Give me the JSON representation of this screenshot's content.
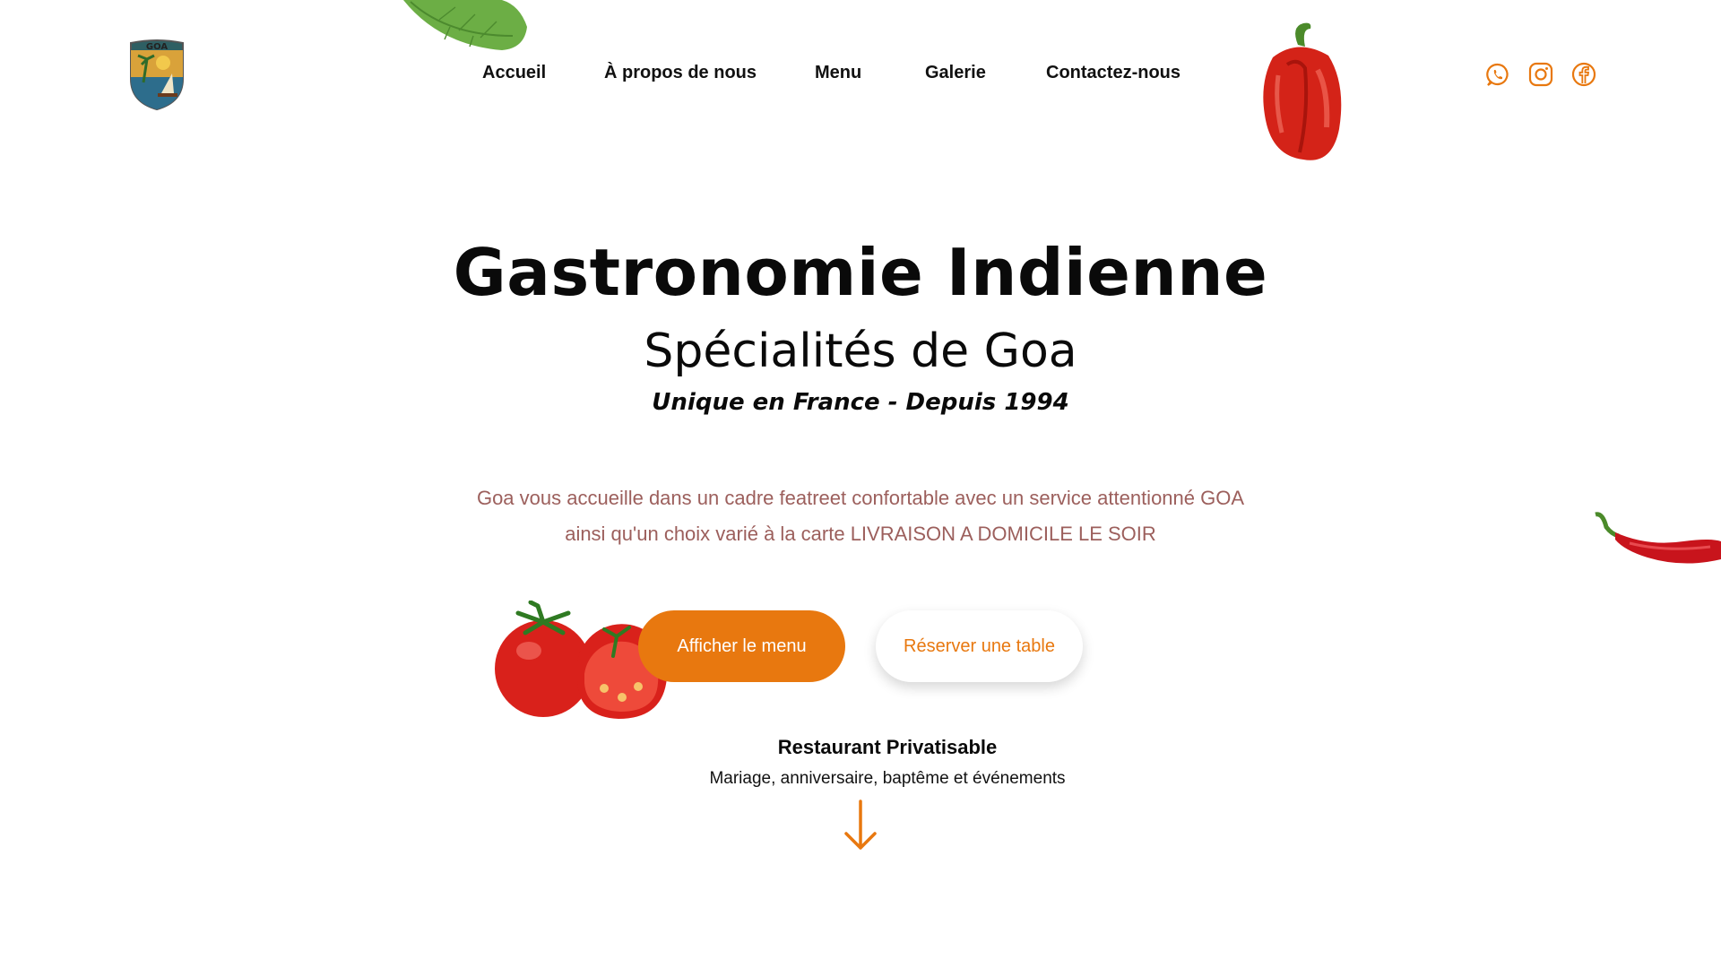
{
  "header": {
    "logo_text": "GOA",
    "nav": [
      {
        "label": "Accueil"
      },
      {
        "label": "À propos de nous"
      },
      {
        "label": "Menu"
      },
      {
        "label": "Galerie"
      },
      {
        "label": "Contactez-nous"
      }
    ],
    "social": [
      {
        "icon": "whatsapp-icon"
      },
      {
        "icon": "instagram-icon"
      },
      {
        "icon": "facebook-icon"
      }
    ]
  },
  "hero": {
    "title": "Gastronomie Indienne",
    "subtitle": "Spécialités de Goa",
    "tagline": "Unique en France - Depuis 1994",
    "description_line1": "Goa vous accueille dans un cadre featreet confortable avec un service attentionné GOA",
    "description_line2": "ainsi qu'un choix varié à la carte LIVRAISON A DOMICILE LE SOIR",
    "primary_button": "Afficher le menu",
    "secondary_button": "Réserver une table"
  },
  "private": {
    "title": "Restaurant Privatisable",
    "text": "Mariage, anniversaire, baptême et événements"
  },
  "colors": {
    "accent": "#e8780f",
    "description": "#9c5f5c",
    "text": "#0a0a0a"
  }
}
